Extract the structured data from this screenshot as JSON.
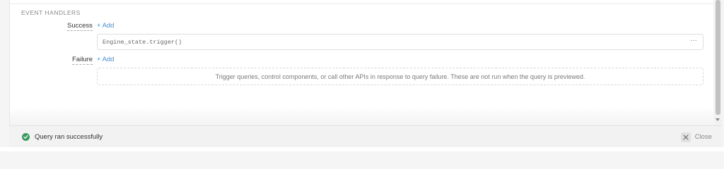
{
  "section": {
    "title": "EVENT HANDLERS"
  },
  "success": {
    "label": "Success",
    "add_label": "Add",
    "handler": "Engine_state.trigger()",
    "menu_label": "···"
  },
  "failure": {
    "label": "Failure",
    "add_label": "Add",
    "empty_text": "Trigger queries, control components, or call other APIs in response to query failure. These are not run when the query is previewed."
  },
  "status": {
    "message": "Query ran successfully",
    "close_label": "Close"
  },
  "colors": {
    "accent": "#3c92dc",
    "success": "#3c9a5f"
  }
}
